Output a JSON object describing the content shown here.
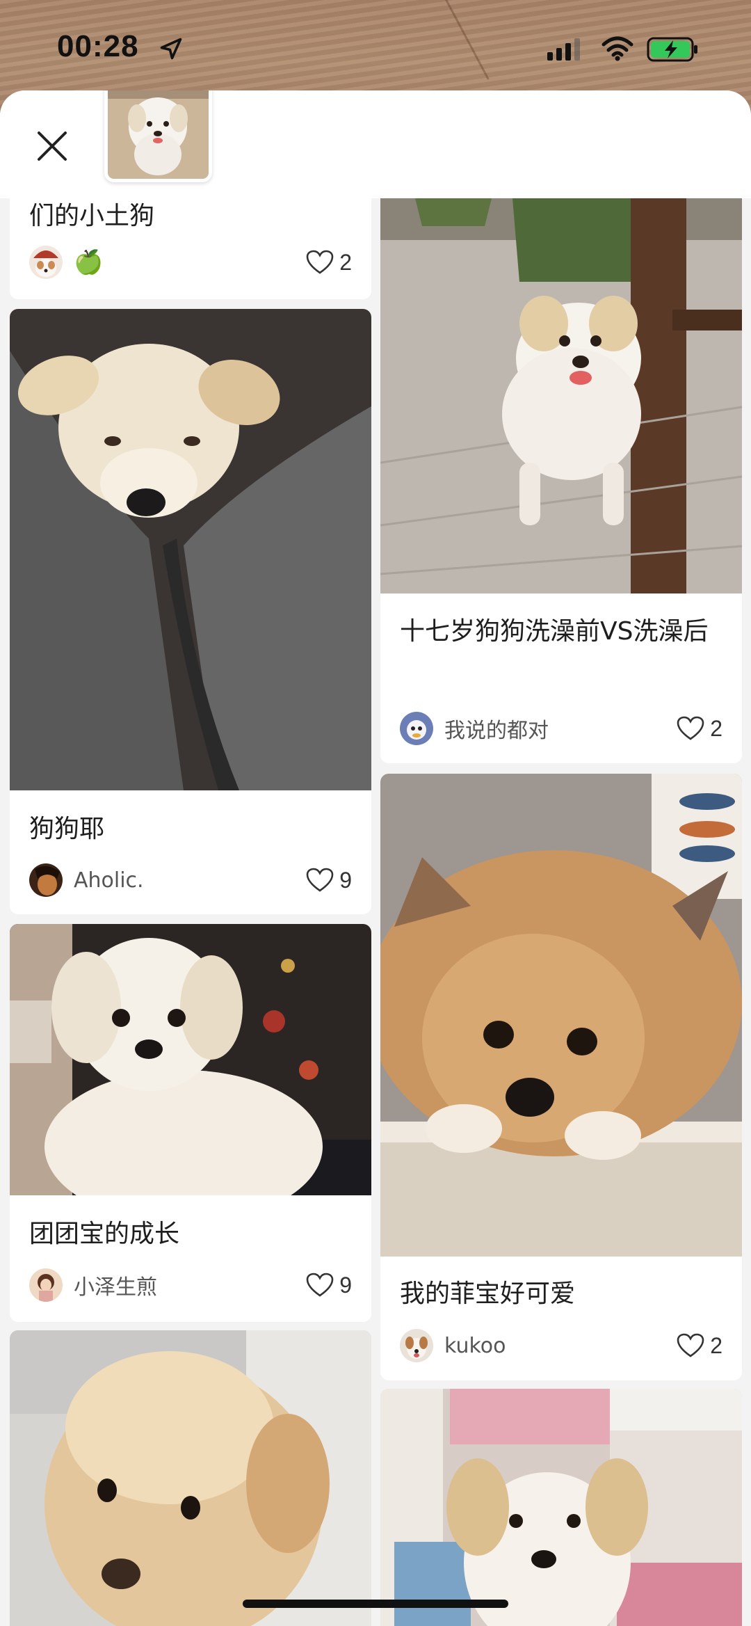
{
  "status_bar": {
    "time": "00:28"
  },
  "header": {
    "close_icon": "close-icon"
  },
  "feed": {
    "cards": [
      {
        "title": "们的小土狗",
        "user": "🍏",
        "likes": "2"
      },
      {
        "title": "十七岁狗狗洗澡前VS洗澡后",
        "user": "我说的都对",
        "likes": "2"
      },
      {
        "title": "狗狗耶",
        "user": "Aholic.",
        "likes": "9"
      },
      {
        "title": "我的菲宝好可爱",
        "user": "kukoo",
        "likes": "2"
      },
      {
        "title": "团团宝的成长",
        "user": "小泽生煎",
        "likes": "9"
      },
      {
        "title": "",
        "user": "",
        "likes": ""
      },
      {
        "title": "",
        "user": "",
        "likes": ""
      }
    ]
  },
  "colors": {
    "background": "#efefef",
    "card": "#ffffff",
    "wood": "#a98468"
  }
}
